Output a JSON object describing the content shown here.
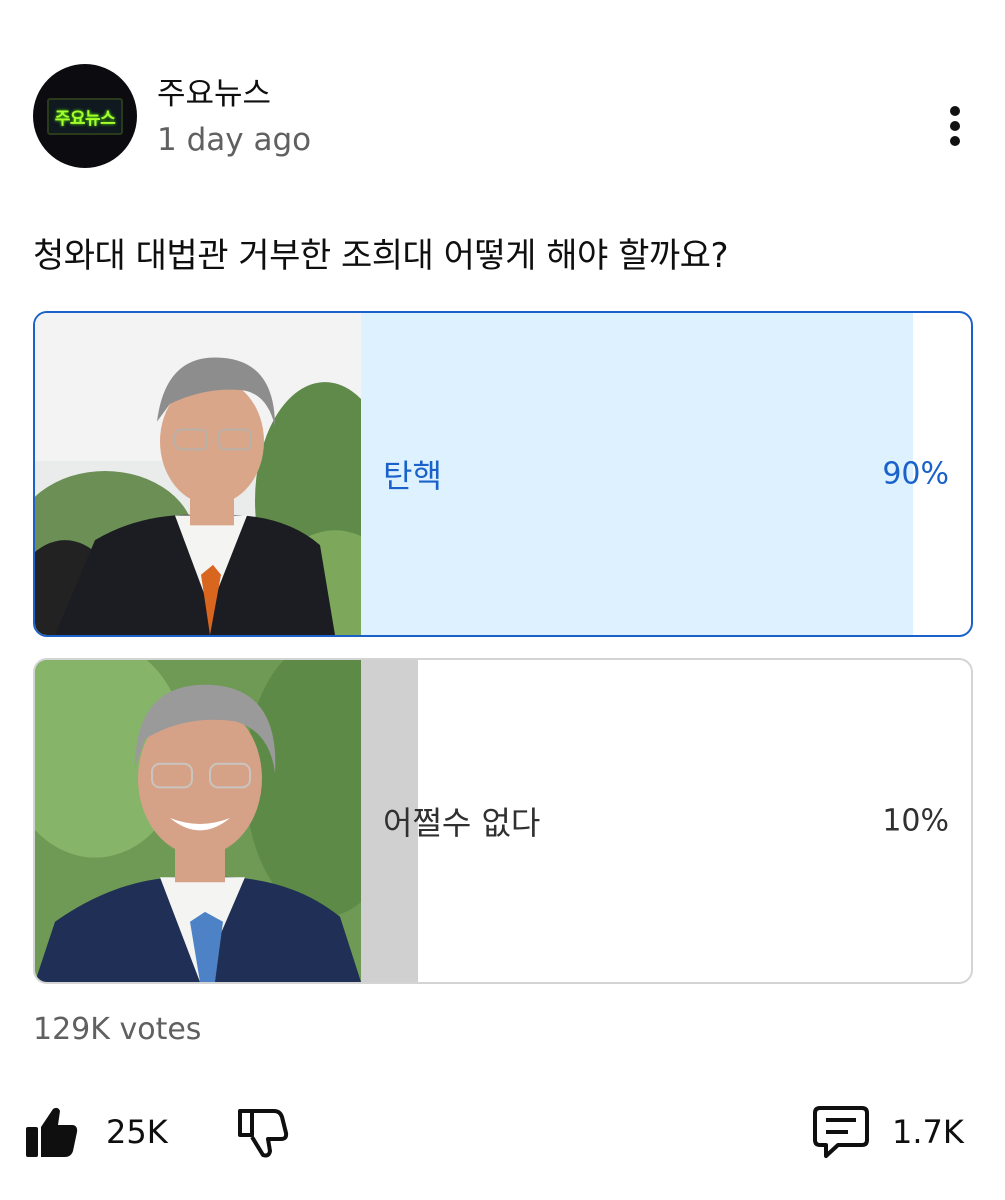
{
  "channel": {
    "name": "주요뉴스",
    "avatar_text": "주요뉴스",
    "time": "1 day ago"
  },
  "poll": {
    "question": "청와대 대법관 거부한 조희대 어떻게 해야 할까요?",
    "options": [
      {
        "label": "탄핵",
        "percent": "90%",
        "fill": 0.9,
        "selected": true
      },
      {
        "label": "어쩔수 없다",
        "percent": "10%",
        "fill": 0.1,
        "selected": false
      }
    ],
    "votes": "129K votes"
  },
  "actions": {
    "like_icon": "thumbs-up-icon",
    "like_count": "25K",
    "dislike_icon": "thumbs-down-icon",
    "comment_icon": "comment-icon",
    "comment_count": "1.7K"
  },
  "colors": {
    "accent": "#1a62c9",
    "selected_fill": "#def1ff",
    "unselected_fill": "#d0d0d0",
    "secondary_text": "#606060"
  }
}
